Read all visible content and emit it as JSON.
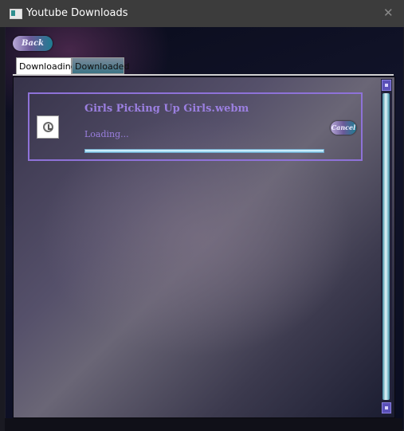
{
  "window": {
    "title": "Youtube Downloads",
    "close_glyph": "✕"
  },
  "nav": {
    "back_label": "Back"
  },
  "tabs": [
    {
      "label": "Downloading",
      "selected": true
    },
    {
      "label": "Downloaded",
      "selected": false
    }
  ],
  "downloads": [
    {
      "file_name": "Girls Picking Up Girls.webm",
      "status": "Loading...",
      "progress": 1.0,
      "icon": "clock-file-icon",
      "cancel_label": "Cancel"
    }
  ],
  "colors": {
    "accent": "#9b7fe0",
    "card_border": "#8e72d8",
    "progress": "#8ed4f2"
  }
}
